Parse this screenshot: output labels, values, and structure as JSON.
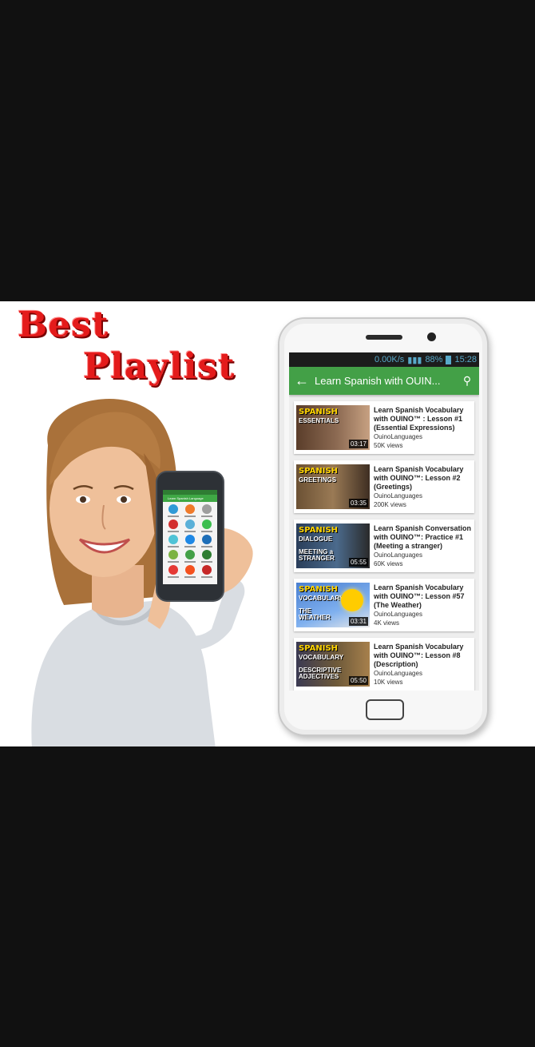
{
  "promo": {
    "line1": "Best",
    "line2": "Playlist"
  },
  "small_phone": {
    "app_title": "Learn Spanish Language"
  },
  "status_bar": {
    "speed": "0.00K/s",
    "battery": "88%",
    "time": "15:28"
  },
  "app_bar": {
    "title": "Learn Spanish with OUIN..."
  },
  "icons": {
    "back": "arrow-left-icon",
    "search": "search-icon"
  },
  "colors": {
    "app_green": "#43a047",
    "promo_red": "#e41b1b",
    "status_blue": "#58a9c9"
  },
  "videos": [
    {
      "thumb_title": "SPANISH",
      "thumb_sub": "ESSENTIALS",
      "thumb_extra": "",
      "duration": "03:17",
      "title": "Learn Spanish Vocabulary with OUINO™ : Lesson #1 (Essential Expressions)",
      "channel": "OuinoLanguages",
      "views": "50K views"
    },
    {
      "thumb_title": "SPANISH",
      "thumb_sub": "GREETINGS",
      "thumb_extra": "",
      "duration": "03:35",
      "title": "Learn Spanish Vocabulary with OUINO™: Lesson #2 (Greetings)",
      "channel": "OuinoLanguages",
      "views": "200K views"
    },
    {
      "thumb_title": "SPANISH",
      "thumb_sub": "DIALOGUE",
      "thumb_extra": "MEETING a STRANGER",
      "duration": "05:55",
      "title": "Learn Spanish Conversation with OUINO™: Practice #1 (Meeting a stranger)",
      "channel": "OuinoLanguages",
      "views": "60K views"
    },
    {
      "thumb_title": "SPANISH",
      "thumb_sub": "VOCABULARY",
      "thumb_extra": "THE WEATHER",
      "duration": "03:31",
      "title": "Learn Spanish Vocabulary with OUINO™: Lesson #57 (The Weather)",
      "channel": "OuinoLanguages",
      "views": "4K views"
    },
    {
      "thumb_title": "SPANISH",
      "thumb_sub": "VOCABULARY",
      "thumb_extra": "DESCRIPTIVE ADJECTIVES",
      "duration": "05:50",
      "title": "Learn Spanish Vocabulary with OUINO™: Lesson #8 (Description)",
      "channel": "OuinoLanguages",
      "views": "10K views"
    }
  ]
}
